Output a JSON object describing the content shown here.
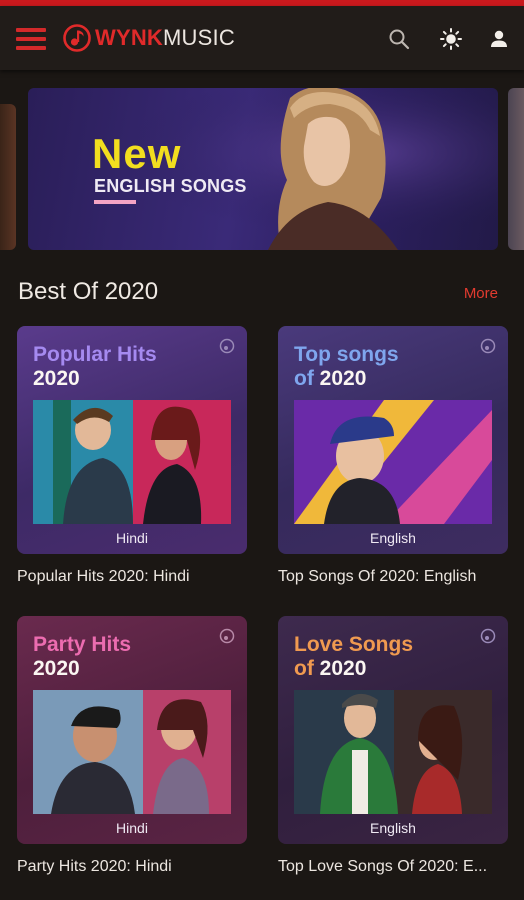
{
  "header": {
    "logo_brand": "WYNK",
    "logo_suffix": "MUSIC",
    "icons": [
      "menu-icon",
      "search-icon",
      "brightness-icon",
      "profile-icon"
    ]
  },
  "banner": {
    "title": "New",
    "subtitle": "ENGLISH SONGS"
  },
  "section": {
    "title": "Best Of 2020",
    "more_label": "More"
  },
  "cards": [
    {
      "line1": "Popular Hits",
      "line2": "2020",
      "language": "Hindi",
      "caption": "Popular Hits 2020: Hindi"
    },
    {
      "line1": "Top songs",
      "line2_of": "of",
      "line2": "2020",
      "language": "English",
      "caption": "Top Songs Of 2020: English"
    },
    {
      "line1": "Party Hits",
      "line2": "2020",
      "language": "Hindi",
      "caption": "Party Hits 2020: Hindi"
    },
    {
      "line1": "Love Songs",
      "line2_of": "of",
      "line2": "2020",
      "language": "English",
      "caption": "Top Love Songs Of 2020: E..."
    }
  ],
  "colors": {
    "accent": "#d3292a",
    "background": "#1b1714",
    "banner_title": "#f2de1f"
  }
}
